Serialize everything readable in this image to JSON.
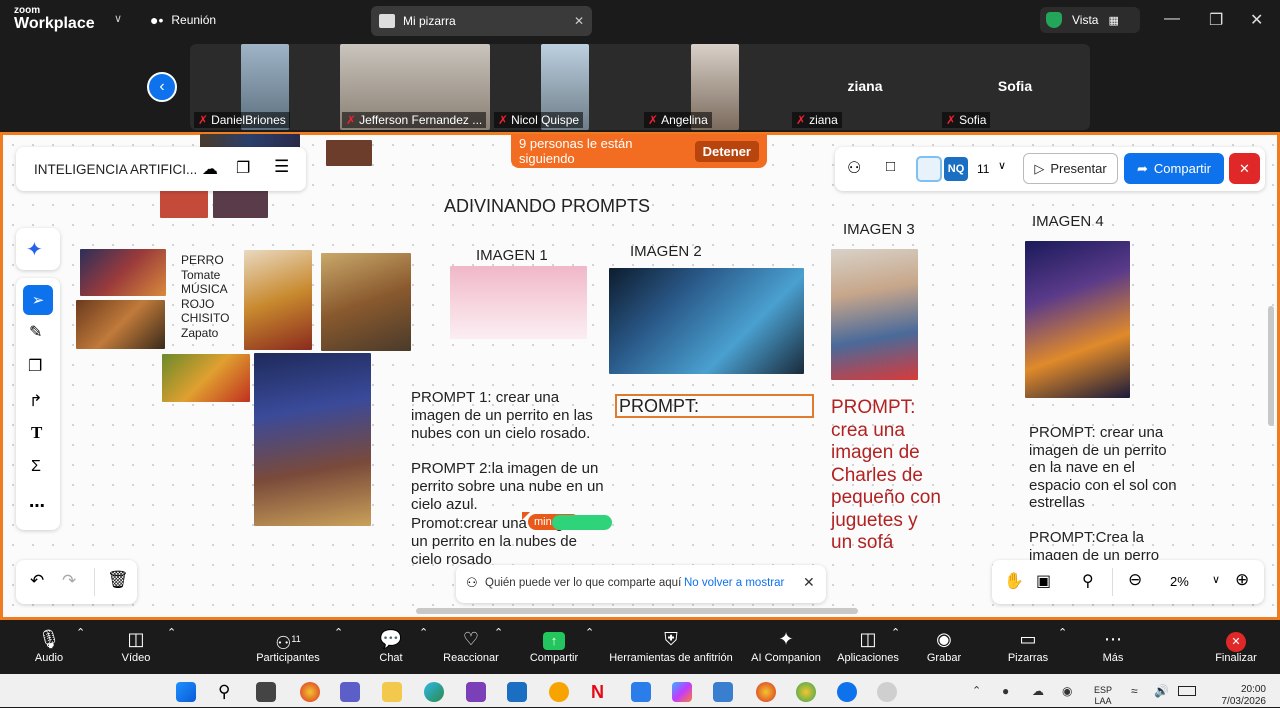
{
  "topbar": {
    "logo_line1": "zoom",
    "logo_line2": "Workplace",
    "meeting_label": "Reunión",
    "tab_title": "Mi pizarra",
    "view_label": "Vista"
  },
  "participants": [
    {
      "name": "DanielBriones"
    },
    {
      "name": "Jefferson Fernandez ..."
    },
    {
      "name": "Nicol Quispe"
    },
    {
      "name": "Angelina"
    },
    {
      "name": "ziana",
      "big": "ziana"
    },
    {
      "name": "Sofia",
      "big": "Sofia"
    }
  ],
  "board": {
    "title_card": "INTELIGENCIA ARTIFICI...",
    "follow_text": "9 personas le están siguiendo",
    "follow_stop": "Detener",
    "share_count": "11",
    "present_label": "Presentar",
    "share_label": "Compartir",
    "nq_badge": "NQ",
    "heading": "ADIVINANDO  PROMPTS",
    "word_list": [
      "PERRO",
      "Tomate",
      "MÚSICA",
      "ROJO",
      "CHISITO",
      "Zapato"
    ],
    "imagen1": "IMAGEN 1",
    "imagen2": "IMAGEN 2",
    "imagen3": "IMAGEN 3",
    "imagen4": "IMAGEN 4",
    "prompt1": "PROMPT 1: crear una imagen de un perrito en las nubes con un cielo rosado.",
    "prompt2": "PROMPT 2:la imagen de un perrito sobre una nube en un cielo azul.",
    "prompt2b": " Promot:crear una imagen de un perrito en la nubes de cielo rosado",
    "prompt_box": "PROMPT:",
    "prompt3": "PROMPT: crea una imagen de Charles de pequeño con juguetes y un sofá",
    "prompt4": "PROMPT: crear una imagen de un perrito en la nave en el espacio con el sol con estrellas",
    "prompt4b": "PROMPT:Crea la imagen de un perro",
    "cursor_label": "min",
    "share_notice": "Quién puede ver lo que comparte aquí",
    "share_notice_link": "No volver a mostrar",
    "zoom_level": "2%"
  },
  "bottombar": {
    "items": [
      {
        "label": "Audio"
      },
      {
        "label": "Vídeo"
      },
      {
        "label": "Participantes",
        "count": "11"
      },
      {
        "label": "Chat"
      },
      {
        "label": "Reaccionar"
      },
      {
        "label": "Compartir"
      },
      {
        "label": "Herramientas de anfitrión"
      },
      {
        "label": "AI Companion"
      },
      {
        "label": "Aplicaciones"
      },
      {
        "label": "Grabar"
      },
      {
        "label": "Pizarras"
      },
      {
        "label": "Más"
      },
      {
        "label": "Finalizar"
      }
    ]
  },
  "taskbar": {
    "lang1": "ESP",
    "lang2": "LAA",
    "time": "20:00",
    "date": "7/03/2026"
  },
  "colors": {
    "accent_orange": "#f26d21",
    "zoom_blue": "#0e72ed",
    "prompt_red": "#b22222",
    "end_red": "#e02828"
  }
}
